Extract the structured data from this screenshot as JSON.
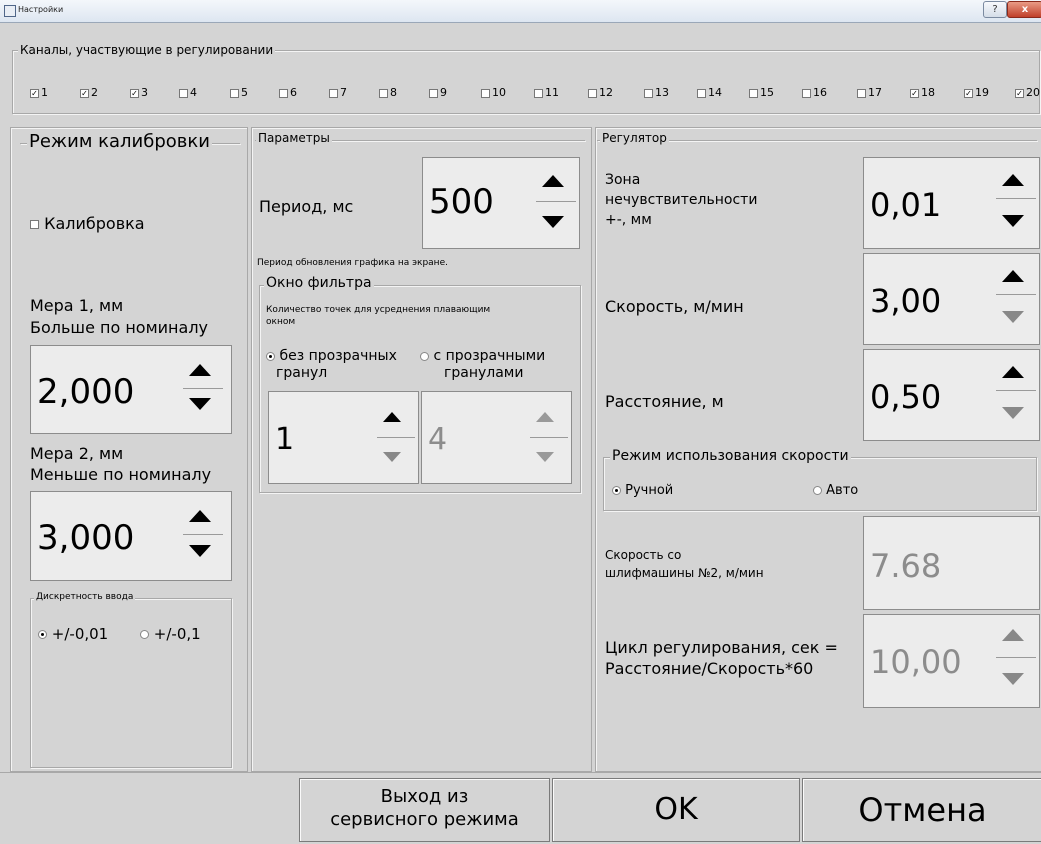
{
  "window": {
    "title": "Настройки",
    "help": "?",
    "close": "x"
  },
  "channels": {
    "title": "Каналы, участвующие в регулировании",
    "items": [
      {
        "label": "1",
        "checked": true
      },
      {
        "label": "2",
        "checked": true
      },
      {
        "label": "3",
        "checked": true
      },
      {
        "label": "4",
        "checked": false
      },
      {
        "label": "5",
        "checked": false
      },
      {
        "label": "6",
        "checked": false
      },
      {
        "label": "7",
        "checked": false
      },
      {
        "label": "8",
        "checked": false
      },
      {
        "label": "9",
        "checked": false
      },
      {
        "label": "10",
        "checked": false
      },
      {
        "label": "11",
        "checked": false
      },
      {
        "label": "12",
        "checked": false
      },
      {
        "label": "13",
        "checked": false
      },
      {
        "label": "14",
        "checked": false
      },
      {
        "label": "15",
        "checked": false
      },
      {
        "label": "16",
        "checked": false
      },
      {
        "label": "17",
        "checked": false
      },
      {
        "label": "18",
        "checked": true
      },
      {
        "label": "19",
        "checked": true
      },
      {
        "label": "20",
        "checked": true
      }
    ]
  },
  "calibration": {
    "title": "Режим калибровки",
    "checkbox_label": "Калибровка",
    "checked": false,
    "measure1_label1": "Мера 1, мм",
    "measure1_label2": "Больше по номиналу",
    "measure1_value": "2,000",
    "measure2_label1": "Мера 2, мм",
    "measure2_label2": "Меньше по номиналу",
    "measure2_value": "3,000",
    "discreteness_title": "Дискретность ввода",
    "option_a": "+/-0,01",
    "option_b": "+/-0,1",
    "selected": "option_a"
  },
  "params": {
    "title": "Параметры",
    "period_label": "Период, мс",
    "period_value": "500",
    "period_hint": "Период обновления графика на экране.",
    "filter_title": "Окно фильтра",
    "filter_hint": "Количество точек для усреднения плавающим окном",
    "radio_a_line1": "без прозрачных",
    "radio_a_line2": "гранул",
    "radio_b_line1": "с прозрачными",
    "radio_b_line2": "гранулами",
    "radio_selected": "a",
    "points_a": "1",
    "points_b": "4"
  },
  "regulator": {
    "title": "Регулятор",
    "zone_label1": "Зона",
    "zone_label2": "нечувствительности",
    "zone_label3": "+-, мм",
    "zone_value": "0,01",
    "speed_label": "Скорость, м/мин",
    "speed_value": "3,00",
    "distance_label": "Расстояние, м",
    "distance_value": "0,50",
    "speed_mode_title": "Режим использования скорости",
    "mode_manual": "Ручной",
    "mode_auto": "Авто",
    "mode_selected": "manual",
    "grinder_label1": "Скорость со",
    "grinder_label2": "шлифмашины №2, м/мин",
    "grinder_value": "7.68",
    "cycle_label1": "Цикл регулирования, сек =",
    "cycle_label2": "Расстояние/Скорость*60",
    "cycle_value": "10,00"
  },
  "footer": {
    "exit_line1": "Выход из",
    "exit_line2": "сервисного режима",
    "ok": "OK",
    "cancel": "Отмена"
  }
}
